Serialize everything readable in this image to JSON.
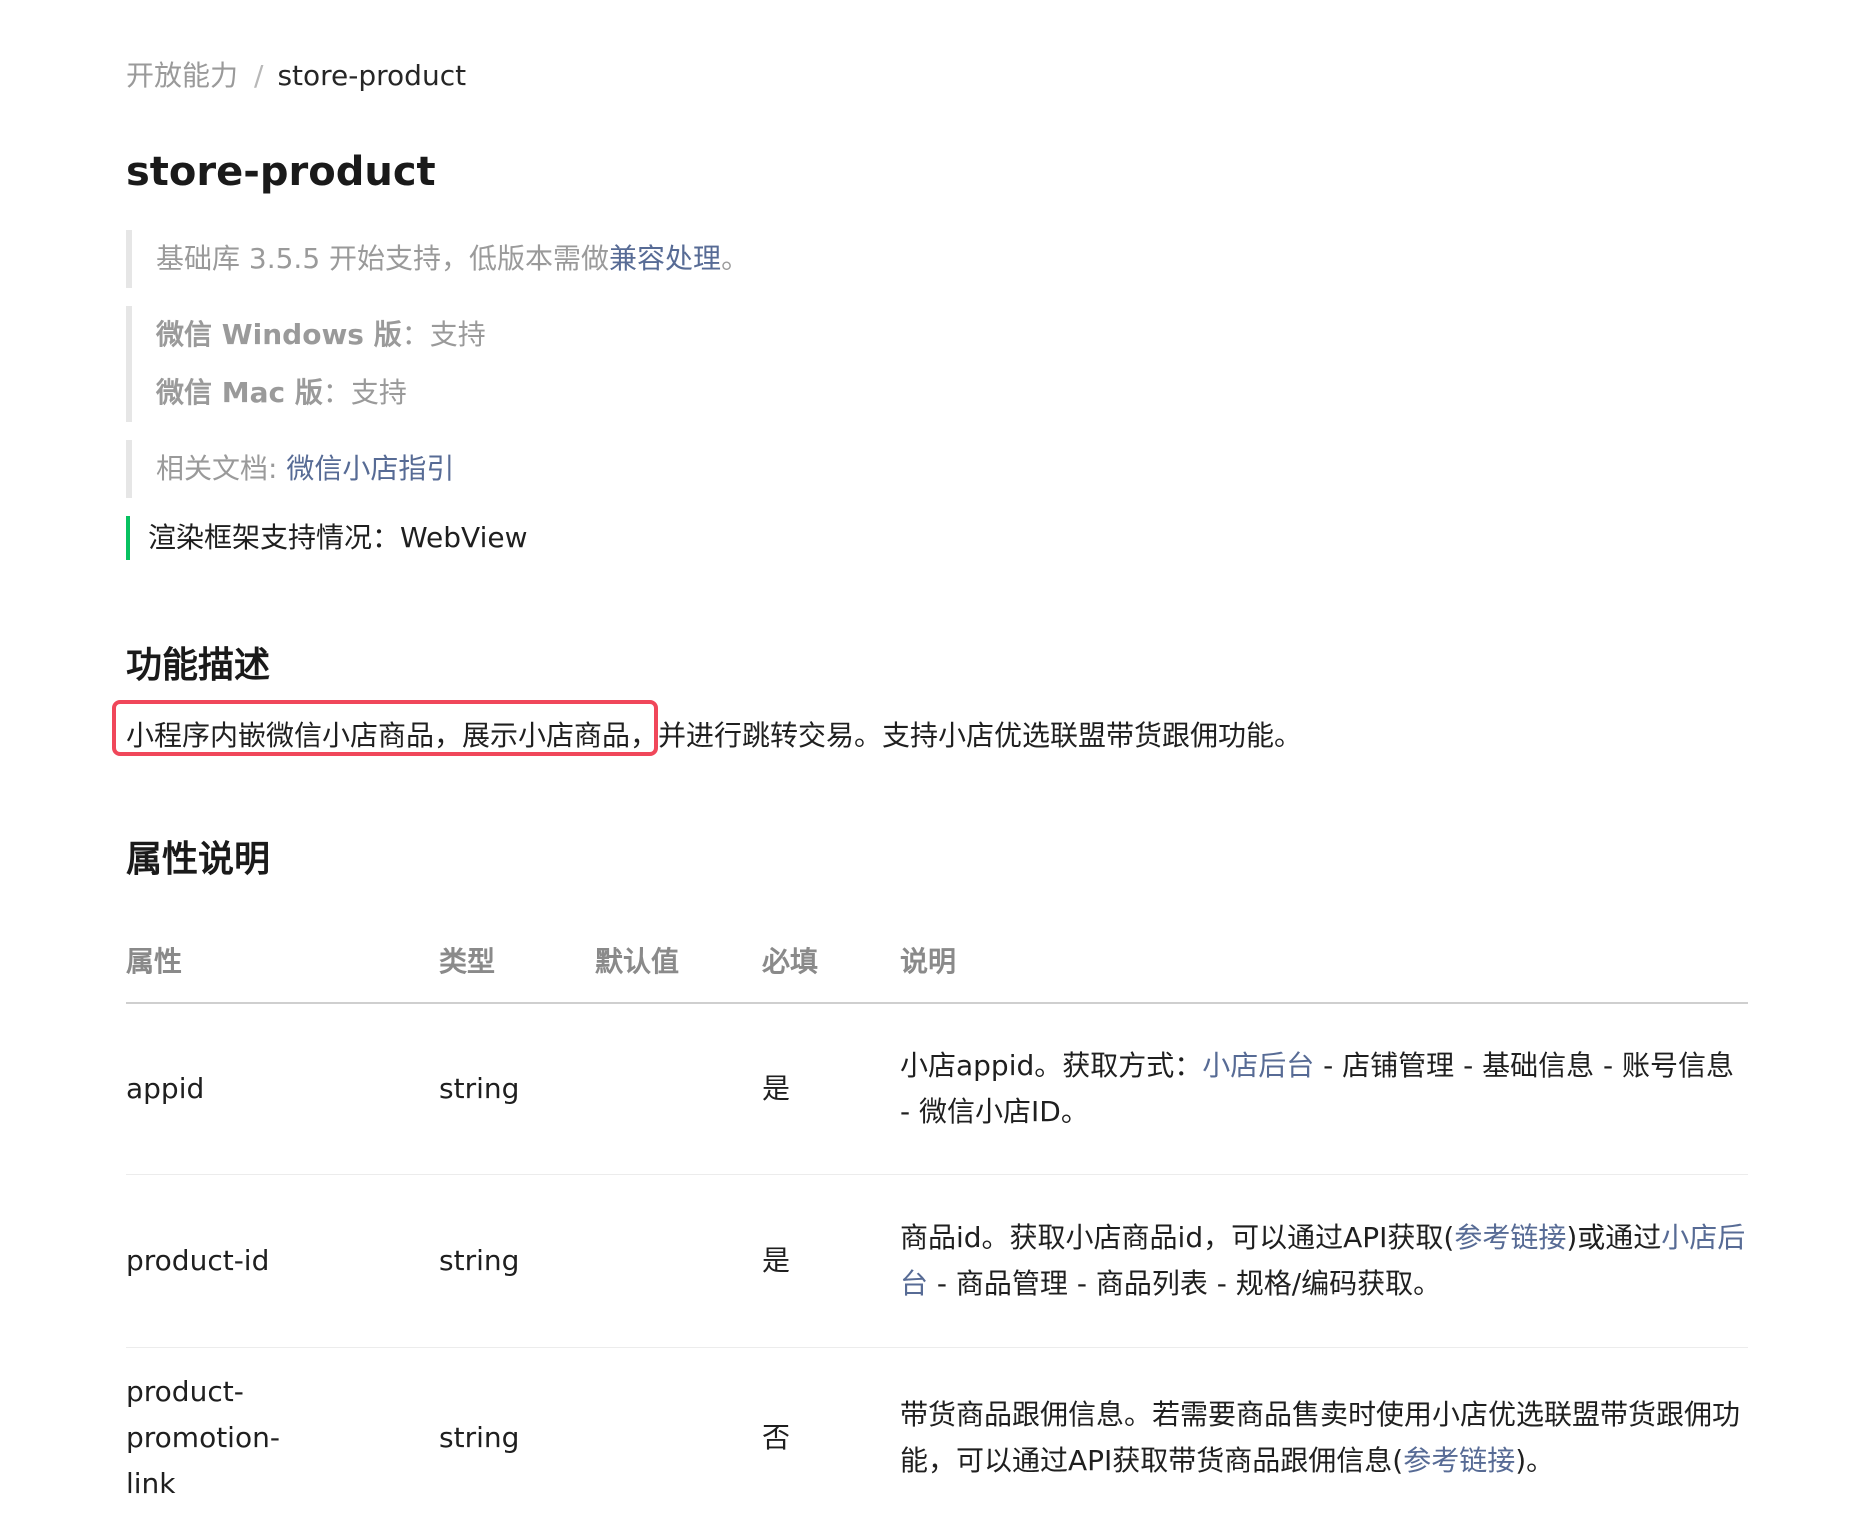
{
  "breadcrumb": {
    "parent": "开放能力",
    "separator": "/",
    "current": "store-product"
  },
  "page_title": "store-product",
  "notes": {
    "basic_prefix": "基础库 3.5.5 开始支持，低版本需做",
    "basic_link": "兼容处理",
    "basic_suffix": "。",
    "windows_label": "微信 Windows 版",
    "windows_value": "：支持",
    "mac_label": "微信 Mac 版",
    "mac_value": "：支持",
    "docs_prefix": "相关文档: ",
    "docs_link": "微信小店指引"
  },
  "render_support": "渲染框架支持情况：WebView",
  "description": {
    "title": "功能描述",
    "text_highlighted": "小程序内嵌微信小店商品，展示小店商品，",
    "text_rest": "并进行跳转交易。支持小店优选联盟带货跟佣功能。"
  },
  "attributes": {
    "title": "属性说明",
    "headers": {
      "attr": "属性",
      "type": "类型",
      "default": "默认值",
      "required": "必填",
      "desc": "说明"
    },
    "rows": [
      {
        "attr": "appid",
        "type": "string",
        "default": "",
        "required": "是",
        "desc_1": "小店appid。获取方式：",
        "desc_link_1": "小店后台",
        "desc_2": " - 店铺管理 - 基础信息 - 账号信息 - 微信小店ID。"
      },
      {
        "attr": "product-id",
        "type": "string",
        "default": "",
        "required": "是",
        "desc_1": "商品id。获取小店商品id，可以通过API获取(",
        "desc_link_1": "参考链接",
        "desc_2": ")或通过",
        "desc_link_2": "小店后台",
        "desc_3": " - 商品管理 - 商品列表 - 规格/编码获取。"
      },
      {
        "attr": "product-promotion-link",
        "type": "string",
        "default": "",
        "required": "否",
        "desc_1": "带货商品跟佣信息。若需要商品售卖时使用小店优选联盟带货跟佣功能，可以通过API获取带货商品跟佣信息(",
        "desc_link_1": "参考链接",
        "desc_2": ")。"
      }
    ]
  },
  "colors": {
    "link": "#576b95",
    "highlight_border": "#f0475a",
    "render_bar": "#07c160",
    "muted_text": "#9a9a9a"
  }
}
